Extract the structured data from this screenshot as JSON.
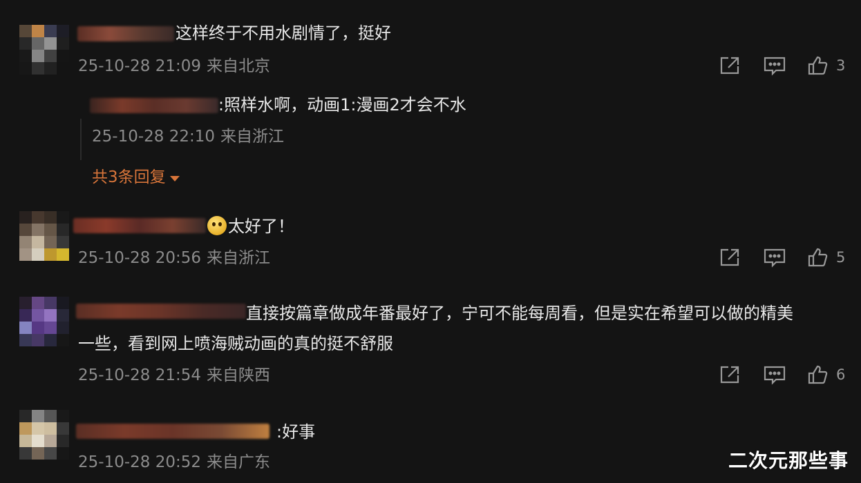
{
  "comments": [
    {
      "text": "这样终于不用水剧情了，挺好",
      "date": "25-10-28 21:09",
      "location": "来自北京",
      "likes": "3",
      "reply": {
        "text": ":照样水啊，动画1:漫画2才会不水",
        "date": "25-10-28 22:10",
        "location": "来自浙江"
      },
      "more_replies": "共3条回复"
    },
    {
      "text": "太好了！",
      "date": "25-10-28 20:56",
      "location": "来自浙江",
      "likes": "5"
    },
    {
      "text_line1": "直接按篇章做成年番最好了，宁可不能每周看，但是实在希望可以做的精美",
      "text_line2": "一些，看到网上喷海贼动画的真的挺不舒服",
      "date": "25-10-28 21:54",
      "location": "来自陕西",
      "likes": "6"
    },
    {
      "text": ":好事",
      "date": "25-10-28 20:52",
      "location": "来自广东"
    }
  ],
  "watermark": "二次元那些事",
  "icons": [
    "share-icon",
    "comment-icon",
    "like-icon",
    "smile-emoji-icon",
    "expand-triangle-icon"
  ],
  "colors": {
    "background": "#141414",
    "accent": "#d8753a",
    "meta": "#8c8c8c"
  }
}
